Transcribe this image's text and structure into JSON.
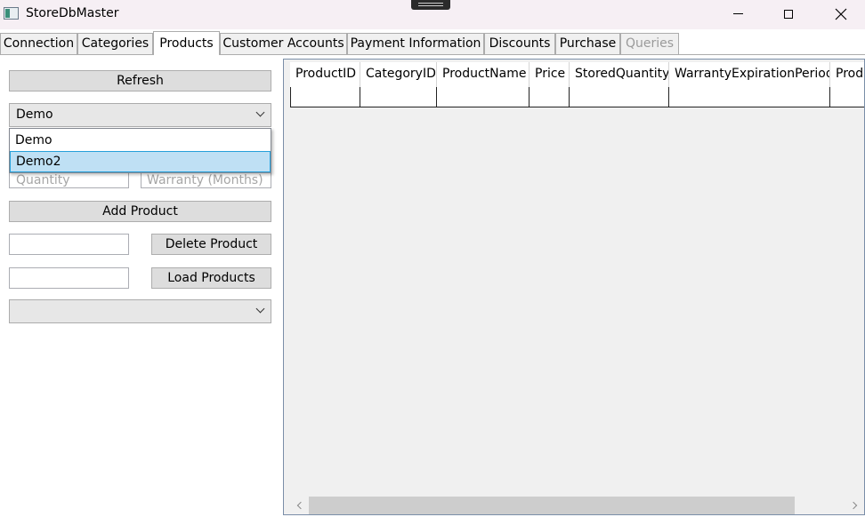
{
  "window": {
    "title": "StoreDbMaster"
  },
  "tabs": [
    {
      "label": "Connection"
    },
    {
      "label": "Categories"
    },
    {
      "label": "Products"
    },
    {
      "label": "Customer Accounts"
    },
    {
      "label": "Payment Information"
    },
    {
      "label": "Discounts"
    },
    {
      "label": "Purchase"
    },
    {
      "label": "Queries"
    }
  ],
  "selected_tab": "Products",
  "disabled_tab": "Queries",
  "products": {
    "refresh_label": "Refresh",
    "category_combo": {
      "selected": "Demo",
      "options": [
        "Demo",
        "Demo2"
      ],
      "highlighted": "Demo2"
    },
    "quantity_placeholder": "Quantity",
    "warranty_placeholder": "Warranty (Months)",
    "add_label": "Add Product",
    "delete_label": "Delete Product",
    "load_label": "Load Products",
    "bottom_combo": {
      "selected": ""
    }
  },
  "grid": {
    "columns": [
      "ProductID",
      "CategoryID",
      "ProductName",
      "Price",
      "StoredQuantity",
      "WarrantyExpirationPeriod",
      "Prod"
    ]
  },
  "colors": {
    "highlight": "#bfe0f4",
    "highlight_border": "#26a0da",
    "button": "#dddddd"
  }
}
